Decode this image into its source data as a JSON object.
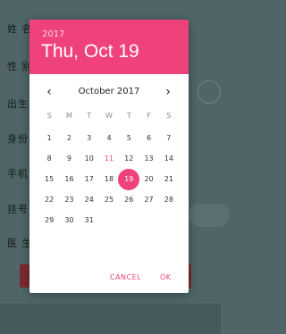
{
  "form": {
    "labels": [
      "姓 名",
      "性 别",
      "出生",
      "身份",
      "手机",
      "挂号",
      "医 生"
    ]
  },
  "dialog": {
    "year": "2017",
    "date": "Thu, Oct 19",
    "month_label": "October 2017",
    "prev_icon": "chevron-left",
    "next_icon": "chevron-right",
    "weekday_headers": [
      "S",
      "M",
      "T",
      "W",
      "T",
      "F",
      "S"
    ],
    "weeks": [
      [
        "1",
        "2",
        "3",
        "4",
        "5",
        "6",
        "7"
      ],
      [
        "8",
        "9",
        "10",
        "11",
        "12",
        "13",
        "14"
      ],
      [
        "15",
        "16",
        "17",
        "18",
        "19",
        "20",
        "21"
      ],
      [
        "22",
        "23",
        "24",
        "25",
        "26",
        "27",
        "28"
      ],
      [
        "29",
        "30",
        "31",
        "",
        "",
        "",
        ""
      ]
    ],
    "today": "11",
    "selected": "19",
    "cancel_label": "CANCEL",
    "ok_label": "OK",
    "accent_color": "#f0427a"
  }
}
